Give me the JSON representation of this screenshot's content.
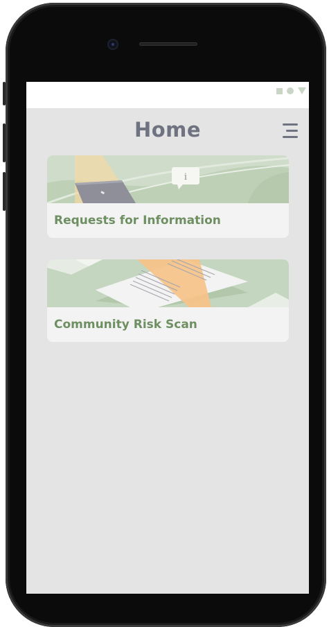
{
  "header": {
    "title": "Home"
  },
  "cards": [
    {
      "label": "Requests for Information",
      "illustration_icon": "info-bubble-icon"
    },
    {
      "label": "Community Risk Scan",
      "illustration_icon": "document-icon"
    }
  ],
  "icons": {
    "menu": "hamburger-menu-icon",
    "status": [
      "square-status-icon",
      "circle-status-icon",
      "signal-icon"
    ]
  },
  "colors": {
    "screen_background": "#e4e4e4",
    "card_background": "#f3f3f3",
    "title_text": "#6f7280",
    "card_label_text": "#6e8f62",
    "illustration_green": "#c6d6bf",
    "illustration_orange": "#f5c48a"
  }
}
